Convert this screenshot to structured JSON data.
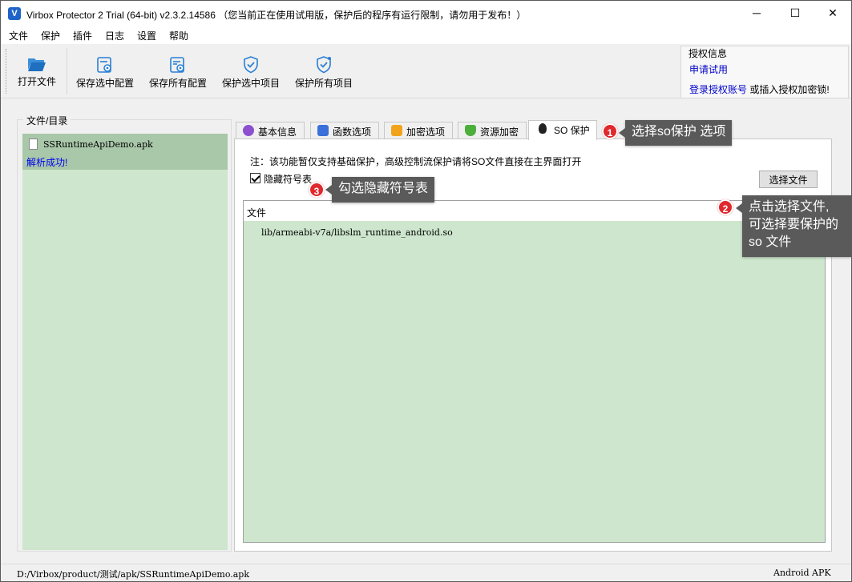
{
  "colors": {
    "accent": "#1e64c8",
    "callout_bg": "#5a5a5a",
    "callout_badge": "#e0282d",
    "list_bg": "#cde6cd",
    "selected_row": "#a9c7a9",
    "link": "#0000cc"
  },
  "window": {
    "logo_letter": "V",
    "title": "Virbox Protector 2 Trial (64-bit) v2.3.2.14586  （您当前正在使用试用版，保护后的程序有运行限制，请勿用于发布！）",
    "controls": {
      "minimize": "─",
      "maximize": "☐",
      "close": "✕"
    }
  },
  "menu": [
    "文件",
    "保护",
    "插件",
    "日志",
    "设置",
    "帮助"
  ],
  "toolbar": {
    "buttons": [
      {
        "label": "打开文件",
        "icon": "folder-open-icon"
      },
      {
        "label": "保存选中配置",
        "icon": "save-config-icon"
      },
      {
        "label": "保存所有配置",
        "icon": "save-all-config-icon"
      },
      {
        "label": "保护选中项目",
        "icon": "shield-check-icon"
      },
      {
        "label": "保护所有项目",
        "icon": "shield-check-all-icon"
      }
    ]
  },
  "auth": {
    "title": "授权信息",
    "apply_link": "申请试用",
    "login_link": "登录授权账号",
    "login_suffix": " 或插入授权加密锁!"
  },
  "file_panel": {
    "title": "文件/目录",
    "file_name": "SSRuntimeApiDemo.apk",
    "status": "解析成功!"
  },
  "tabs": [
    {
      "label": "基本信息",
      "icon": "chat-bubble-icon",
      "active": false
    },
    {
      "label": "函数选项",
      "icon": "waveform-icon",
      "active": false
    },
    {
      "label": "加密选项",
      "icon": "lock-icon",
      "active": false
    },
    {
      "label": "资源加密",
      "icon": "shield-green-icon",
      "active": false
    },
    {
      "label": "SO 保护",
      "icon": "linux-penguin-icon",
      "active": true
    }
  ],
  "so_protect": {
    "note": "注：该功能暂仅支持基础保护，高级控制流保护请将SO文件直接在主界面打开",
    "hide_symbols_label": "隐藏符号表",
    "hide_symbols_checked": true,
    "select_file_button": "选择文件",
    "table_header": "文件",
    "files": [
      "lib/armeabi-v7a/libslm_runtime_android.so"
    ]
  },
  "statusbar": {
    "path": "D:/Virbox/product/测试/apk/SSRuntimeApiDemo.apk",
    "type": "Android APK"
  },
  "annotations": [
    {
      "number": "1",
      "text": "选择so保护 选项"
    },
    {
      "number": "2",
      "text": "点击选择文件,\n可选择要保护的\nso 文件"
    },
    {
      "number": "3",
      "text": "勾选隐藏符号表"
    }
  ]
}
